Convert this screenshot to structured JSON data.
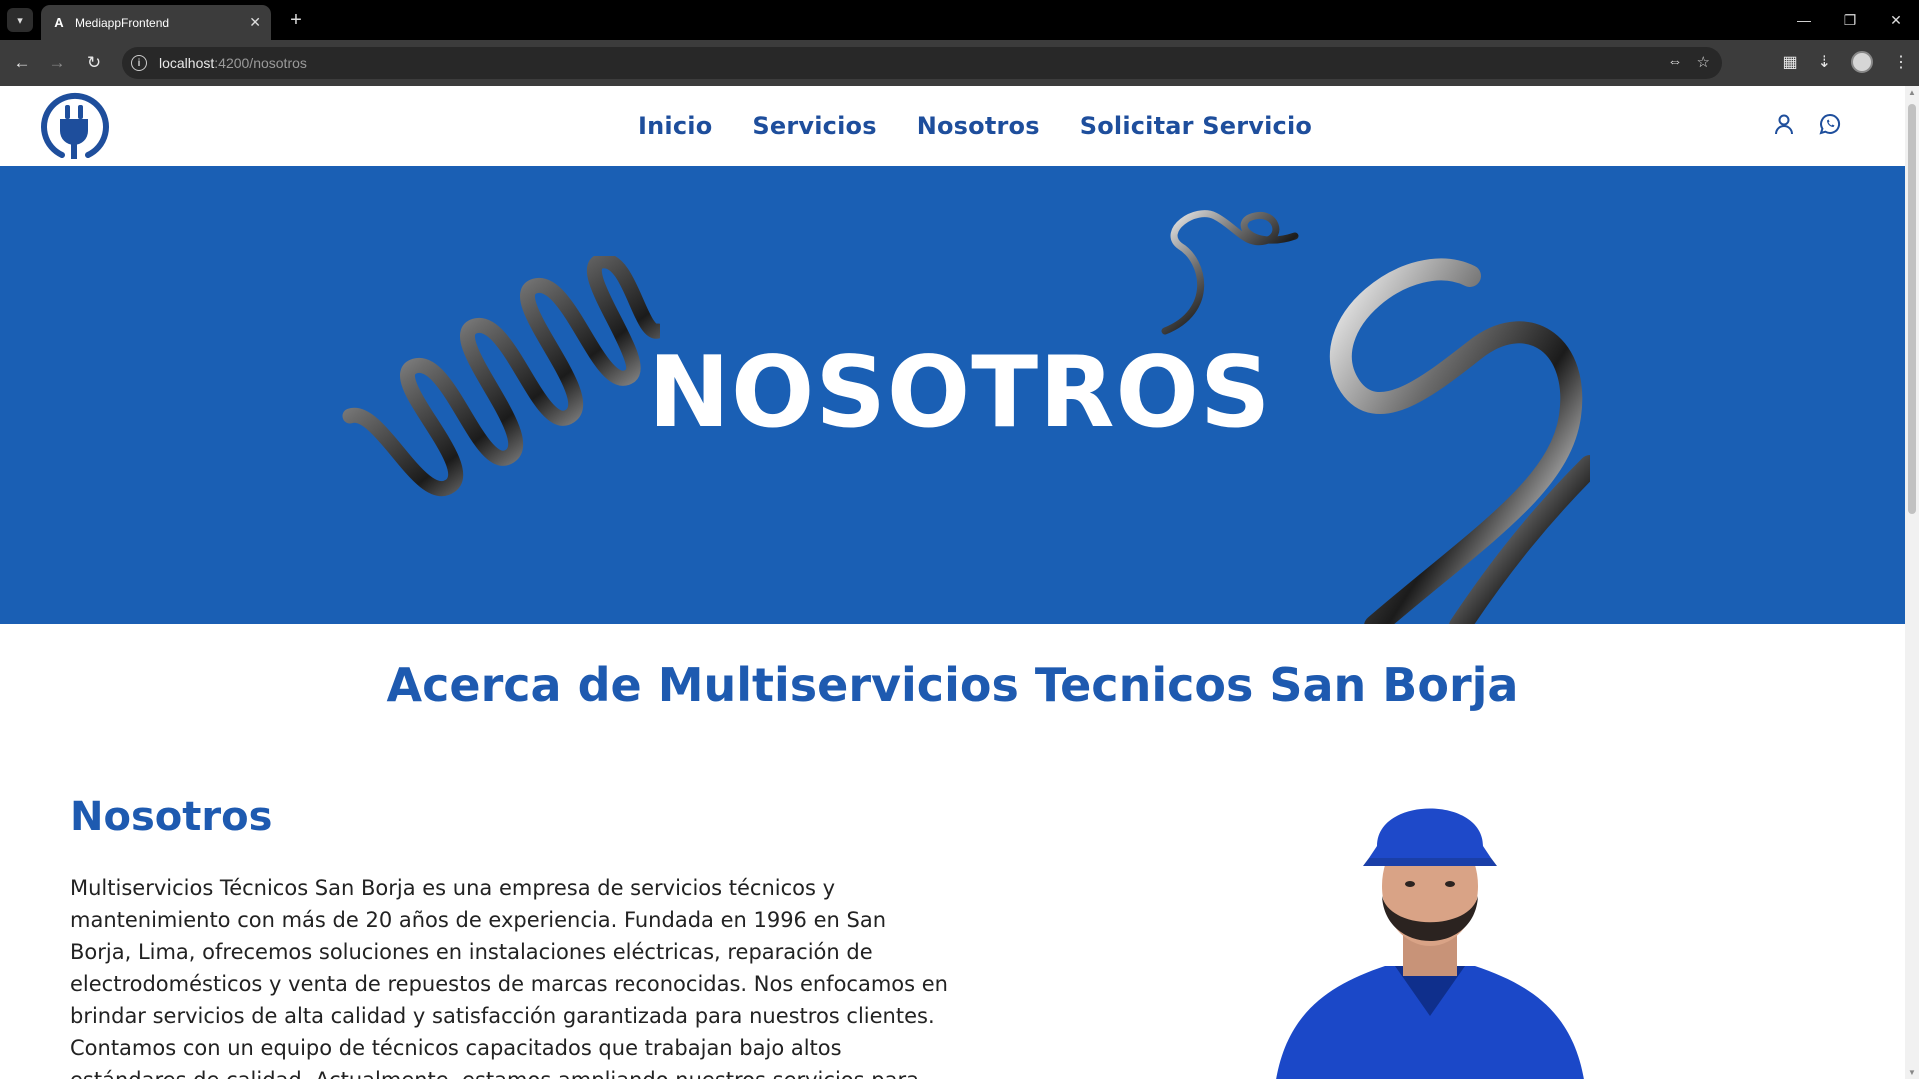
{
  "browser": {
    "tab_title": "MediappFrontend",
    "url_host": "localhost",
    "url_path": ":4200/nosotros"
  },
  "nav": {
    "items": [
      {
        "label": "Inicio"
      },
      {
        "label": "Servicios"
      },
      {
        "label": "Nosotros"
      },
      {
        "label": "Solicitar Servicio"
      }
    ]
  },
  "hero": {
    "title": "NOSOTROS"
  },
  "about": {
    "title": "Acerca de Multiservicios Tecnicos San Borja",
    "section_title": "Nosotros",
    "section_text": "Multiservicios Técnicos San Borja es una empresa de servicios técnicos y mantenimiento con más de 20 años de experiencia. Fundada en 1996 en San Borja, Lima, ofrecemos soluciones en instalaciones eléctricas, reparación de electrodomésticos y venta de repuestos de marcas reconocidas. Nos enfocamos en brindar servicios de alta calidad y satisfacción garantizada para nuestros clientes. Contamos con un equipo de técnicos capacitados que trabajan bajo altos estándares de calidad. Actualmente, estamos ampliando nuestros servicios para incluir pintura"
  },
  "colors": {
    "brand": "#1a5fb4",
    "nav_text": "#1e4e9c",
    "heading": "#1e5ab0"
  },
  "icons": [
    "plug-logo-icon",
    "user-icon",
    "whatsapp-icon",
    "search-icon"
  ]
}
